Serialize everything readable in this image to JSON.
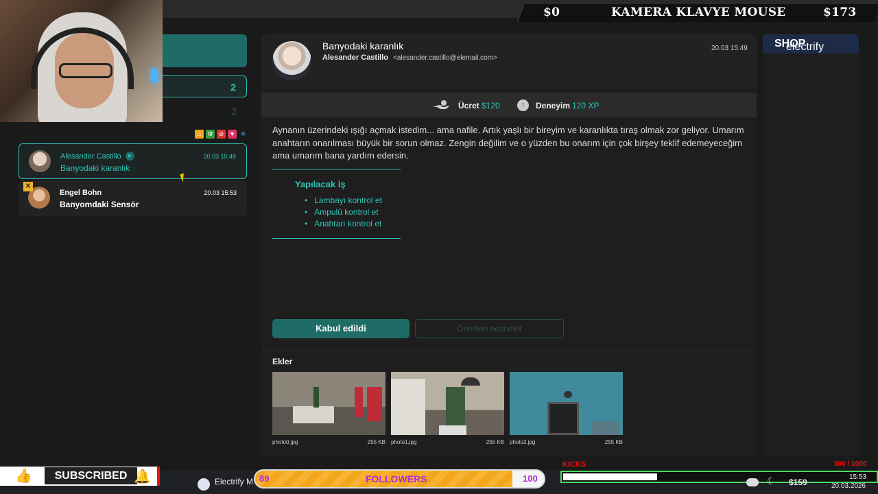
{
  "ticker": {
    "left_amount": "$0",
    "title": "KAMERA KLAVYE MOUSE",
    "right_amount": "$173"
  },
  "inbox": {
    "count_primary": "2",
    "count_secondary": "2",
    "items": [
      {
        "from": "Alesander Castillo",
        "subject": "Banyodaki karanlık",
        "time": "20.03 15:49",
        "active": true
      },
      {
        "from": "Engel Bohn",
        "subject": "Banyomdaki Sensör",
        "time": "20.03 15:53",
        "active": false
      }
    ]
  },
  "mail": {
    "subject": "Banyodaki karanlık",
    "from_name": "Alesander Castillo",
    "from_address": "<alesander.castillo@elemail.com>",
    "time": "20.03 15:49",
    "reward_label": "Ücret",
    "reward_value": "$120",
    "xp_label": "Deneyim",
    "xp_value": "120 XP",
    "body": "Aynanın üzerindeki ışığı açmak istedim... ama nafile. Artık yaşlı bir bireyim ve karanlıkta tıraş olmak zor geliyor. Umarım anahtarın onarılması büyük bir sorun olmaz. Zengin değilim ve o yüzden bu onarım için çok birşey teklif edemeyeceğim ama umarım bana yardım edersin.",
    "todo_title": "Yapılacak iş",
    "todo_items": [
      "Lambayı kontrol et",
      "Ampulü kontrol et",
      "Anahtarı kontrol et"
    ],
    "accept_button": "Kabul edildi",
    "suggested_button": "Önerilen nesneler",
    "attachments_title": "Ekler",
    "attachments": [
      {
        "name": "photo0.jpg",
        "size": "255 KB"
      },
      {
        "name": "photo1.jpg",
        "size": "255 KB"
      },
      {
        "name": "photo2.jpg",
        "size": "255 KB"
      }
    ]
  },
  "shop": {
    "logo_part1": "electrify",
    "logo_part2": "SHOP"
  },
  "overlay": {
    "subscribed": "SUBSCRIBED",
    "followers_label": "FOLLOWERS",
    "followers_current": "89",
    "followers_goal": "100",
    "followers_progress": 0.89,
    "kicks_label": "KICKS",
    "kicks_count": "300 / 1000",
    "kicks_progress": 0.3
  },
  "taskbar": {
    "app_label": "Electrify M",
    "money": "$159",
    "time": "15:53",
    "date": "20.03.2026"
  },
  "colors": {
    "accent": "#2ec4b6",
    "accent_dark": "#1f6b66",
    "shop_bg": "#1d2b46"
  }
}
